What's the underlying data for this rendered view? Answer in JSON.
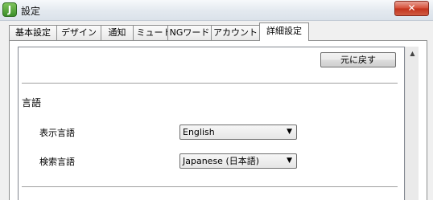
{
  "window": {
    "title": "設定",
    "app_icon_glyph": "J",
    "close_glyph": "✕"
  },
  "tabs": [
    {
      "label": "基本設定",
      "active": false
    },
    {
      "label": "デザイン",
      "active": false
    },
    {
      "label": "通知",
      "active": false
    },
    {
      "label": "ミュート",
      "active": false
    },
    {
      "label": "NGワード",
      "active": false
    },
    {
      "label": "アカウント",
      "active": false
    },
    {
      "label": "詳細設定",
      "active": true
    }
  ],
  "panel": {
    "reset_button": "元に戻す",
    "language_section": {
      "heading": "言語",
      "display_language": {
        "label": "表示言語",
        "value": "English"
      },
      "search_language": {
        "label": "検索言語",
        "value": "Japanese (日本語)"
      }
    }
  },
  "icons": {
    "dropdown_arrow": "▼",
    "scroll_up_arrow": "▲"
  },
  "colors": {
    "close_button": "#c2331c",
    "app_icon": "#3c8f2a"
  }
}
